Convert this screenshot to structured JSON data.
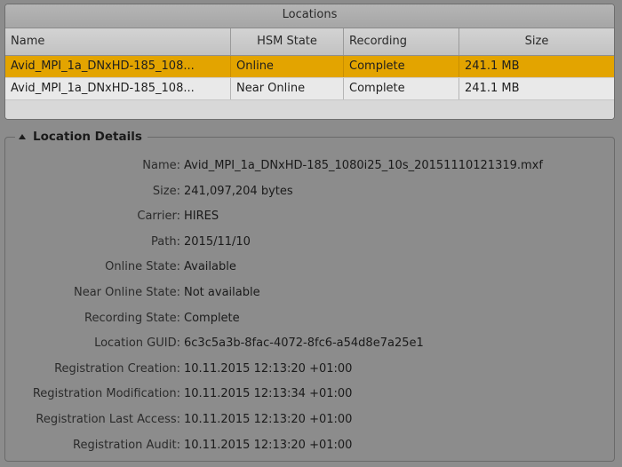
{
  "locations": {
    "title": "Locations",
    "columns": [
      "Name",
      "HSM State",
      "Recording",
      "Size"
    ],
    "rows": [
      {
        "name": "Avid_MPI_1a_DNxHD-185_108...",
        "hsm_state": "Online",
        "recording": "Complete",
        "size": "241.1 MB",
        "selected": true
      },
      {
        "name": "Avid_MPI_1a_DNxHD-185_108...",
        "hsm_state": "Near Online",
        "recording": "Complete",
        "size": "241.1 MB",
        "selected": false
      }
    ]
  },
  "details": {
    "title": "Location Details",
    "fields": [
      {
        "label": "Name:",
        "value": "Avid_MPI_1a_DNxHD-185_1080i25_10s_20151110121319.mxf"
      },
      {
        "label": "Size:",
        "value": "241,097,204 bytes"
      },
      {
        "label": "Carrier:",
        "value": "HIRES"
      },
      {
        "label": "Path:",
        "value": "2015/11/10"
      },
      {
        "label": "Online State:",
        "value": "Available"
      },
      {
        "label": "Near Online State:",
        "value": "Not available"
      },
      {
        "label": "Recording State:",
        "value": "Complete"
      },
      {
        "label": "Location GUID:",
        "value": "6c3c5a3b-8fac-4072-8fc6-a54d8e7a25e1"
      },
      {
        "label": "Registration Creation:",
        "value": "10.11.2015 12:13:20 +01:00"
      },
      {
        "label": "Registration Modification:",
        "value": "10.11.2015 12:13:34 +01:00"
      },
      {
        "label": "Registration Last Access:",
        "value": "10.11.2015 12:13:20 +01:00"
      },
      {
        "label": "Registration Audit:",
        "value": "10.11.2015 12:13:20 +01:00"
      }
    ]
  },
  "colors": {
    "background": "#8c8c8c",
    "selected_row": "#e3a400",
    "panel": "#c9c9c9"
  },
  "icons": {
    "details_toggle": "collapse-triangle-icon"
  }
}
